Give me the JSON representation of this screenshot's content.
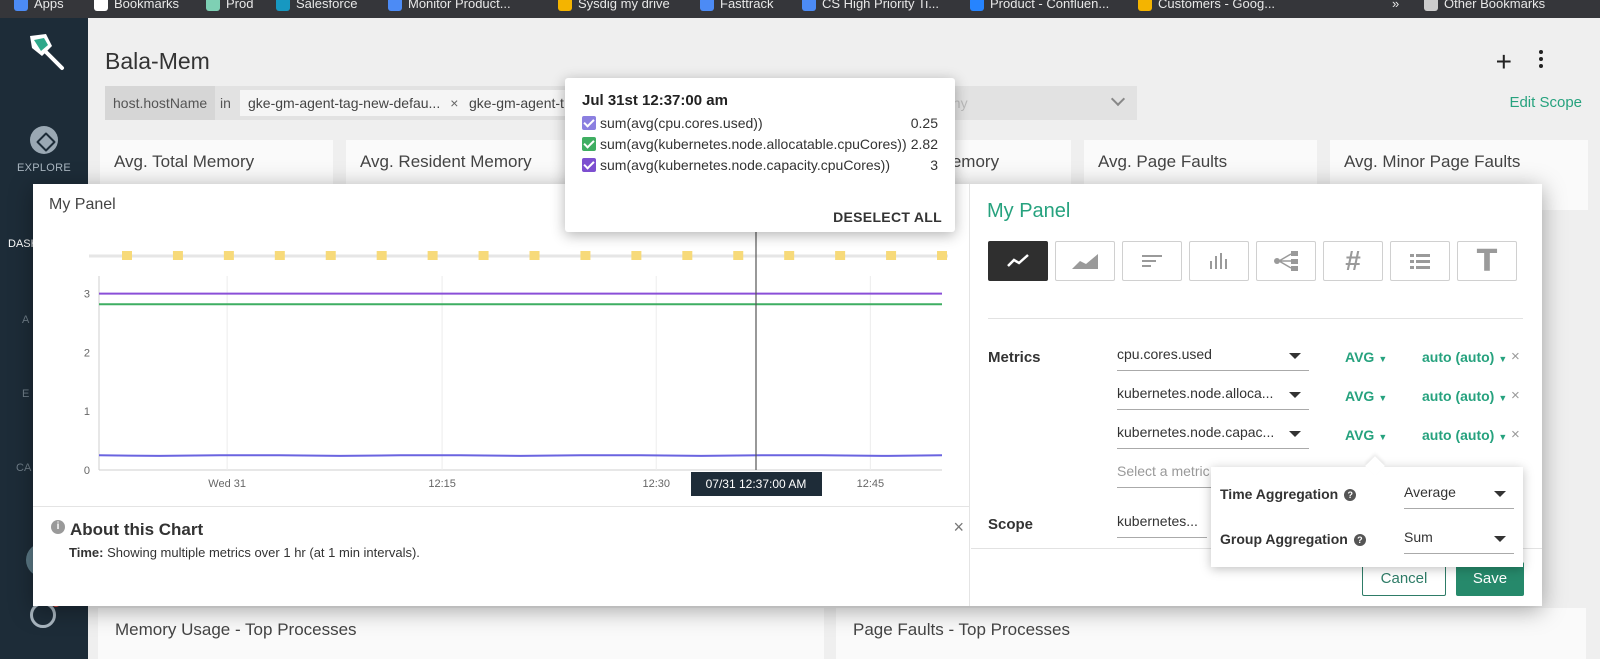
{
  "bookmarks": [
    {
      "label": "Apps",
      "icon": "apps-grid-icon",
      "color": "#4c8bf5"
    },
    {
      "label": "Bookmarks",
      "icon": "star-icon",
      "color": "#ffffff"
    },
    {
      "label": "Prod",
      "icon": "magnifier-icon",
      "color": "#7ed0b4"
    },
    {
      "label": "Salesforce",
      "icon": "salesforce-cloud-icon",
      "color": "#1798c1"
    },
    {
      "label": "Monitor Product...",
      "icon": "diamond-icon",
      "color": "#4c8bf5"
    },
    {
      "label": "Sysdig my drive",
      "icon": "drive-icon",
      "color": "#f4b400"
    },
    {
      "label": "Fasttrack",
      "icon": "diamond-icon",
      "color": "#4c8bf5"
    },
    {
      "label": "CS High Priority Ti...",
      "icon": "diamond-icon",
      "color": "#4c8bf5"
    },
    {
      "label": "Product - Confluen...",
      "icon": "confluence-icon",
      "color": "#2684ff"
    },
    {
      "label": "Customers - Goog...",
      "icon": "drive-icon",
      "color": "#f4b400"
    },
    {
      "label": "»",
      "icon": "",
      "color": ""
    },
    {
      "label": "Other Bookmarks",
      "icon": "folder-icon",
      "color": "#cccccc"
    }
  ],
  "nav": {
    "explore": "EXPLORE",
    "dash_fragment": "DASH",
    "fragment_a": "A",
    "fragment_e": "E",
    "fragment_ca": "CA"
  },
  "dashboard": {
    "title": "Bala-Mem",
    "edit_scope": "Edit Scope",
    "scope_key": "host.hostName",
    "scope_op": "in",
    "scope_chips": [
      "gke-gm-agent-tag-new-defau...",
      "gke-gm-agent-t"
    ],
    "scope_faded": "any",
    "tiles": [
      "Avg. Total Memory",
      "Avg. Resident Memory",
      "Avg. Swap Memory",
      "Avg. Page Faults",
      "Avg. Minor Page Faults"
    ],
    "bottom_tiles": [
      "Memory Usage - Top Processes",
      "Page Faults - Top Processes"
    ]
  },
  "panel": {
    "title": "My Panel",
    "about_title": "About this Chart",
    "about_label": "Time:",
    "about_text": "Showing multiple metrics over 1 hr (at 1 min intervals).",
    "hover_label": "07/31 12:37:00 AM"
  },
  "config": {
    "title": "My Panel",
    "chart_types": [
      "line-chart-icon",
      "area-chart-icon",
      "toplist-icon",
      "histogram-icon",
      "topology-icon",
      "number-icon",
      "table-icon",
      "text-icon"
    ],
    "metrics_label": "Metrics",
    "scope_label": "Scope",
    "metrics": [
      {
        "name": "cpu.cores.used",
        "time_agg": "AVG",
        "group_agg": "auto (auto)"
      },
      {
        "name": "kubernetes.node.alloca...",
        "time_agg": "AVG",
        "group_agg": "auto (auto)"
      },
      {
        "name": "kubernetes.node.capac...",
        "time_agg": "AVG",
        "group_agg": "auto (auto)"
      }
    ],
    "metric_placeholder": "Select a metric",
    "scope_value": "kubernetes...",
    "cancel": "Cancel",
    "save": "Save",
    "time_aggregation_label": "Time Aggregation",
    "time_aggregation_value": "Average",
    "group_aggregation_label": "Group Aggregation",
    "group_aggregation_value": "Sum"
  },
  "tooltip": {
    "title": "Jul 31st 12:37:00 am",
    "rows": [
      {
        "name": "sum(avg(cpu.cores.used))",
        "value": "0.25",
        "color": "#8b7fe0"
      },
      {
        "name": "sum(avg(kubernetes.node.allocatable.cpuCores))",
        "value": "2.82",
        "color": "#3fae62"
      },
      {
        "name": "sum(avg(kubernetes.node.capacity.cpuCores))",
        "value": "3",
        "color": "#7d4fd0"
      }
    ],
    "deselect": "DESELECT ALL"
  },
  "chart_data": {
    "type": "line",
    "x_ticks": [
      "Wed 31",
      "12:15",
      "12:30",
      "12:45"
    ],
    "y_ticks": [
      "0",
      "1",
      "2",
      "3"
    ],
    "ylim": [
      0,
      3.3
    ],
    "event_markers": 17,
    "hover_index": 8,
    "series": [
      {
        "name": "sum(avg(kubernetes.node.capacity.cpuCores))",
        "color": "#8a4fd8",
        "values": [
          3,
          3,
          3,
          3,
          3,
          3,
          3,
          3,
          3,
          3,
          3,
          3,
          3,
          3,
          3
        ]
      },
      {
        "name": "sum(avg(kubernetes.node.allocatable.cpuCores))",
        "color": "#3fae62",
        "values": [
          2.82,
          2.82,
          2.82,
          2.82,
          2.82,
          2.82,
          2.82,
          2.82,
          2.82,
          2.82,
          2.82,
          2.82,
          2.82,
          2.82,
          2.82
        ]
      },
      {
        "name": "sum(avg(cpu.cores.used))",
        "color": "#6a64e0",
        "values": [
          0.25,
          0.24,
          0.25,
          0.25,
          0.24,
          0.25,
          0.25,
          0.24,
          0.25,
          0.25,
          0.24,
          0.25,
          0.25,
          0.24,
          0.25
        ]
      }
    ]
  }
}
